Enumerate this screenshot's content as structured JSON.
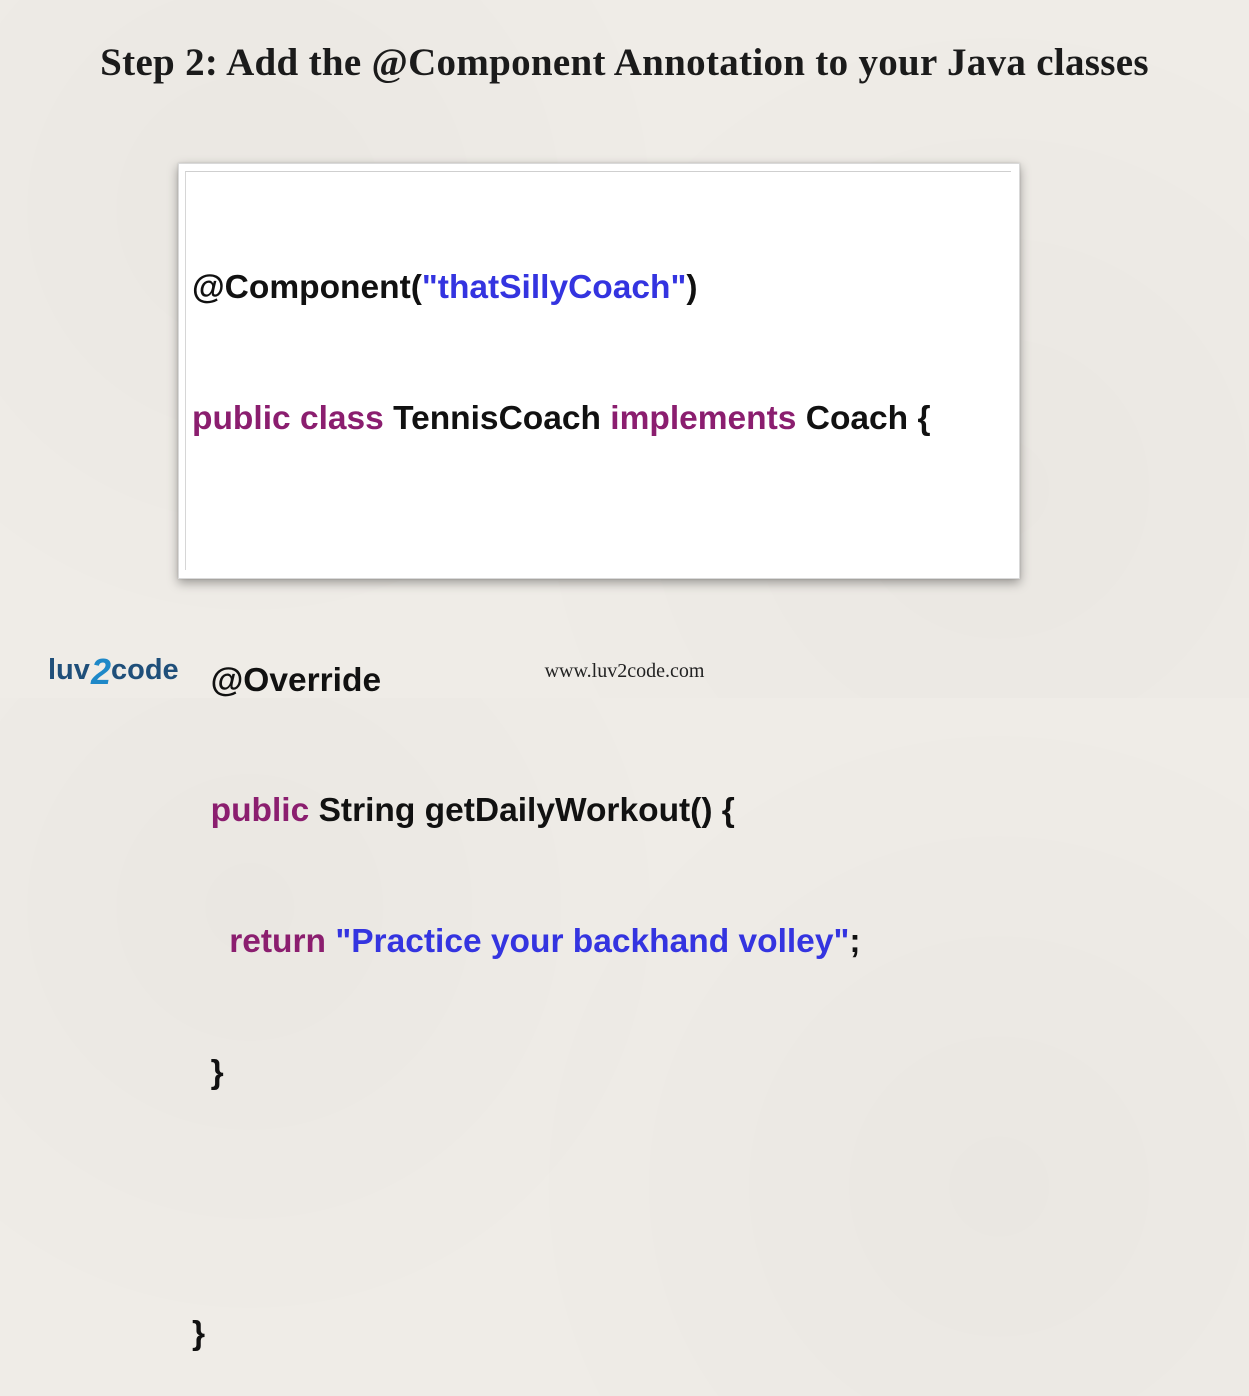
{
  "slide": {
    "title": "Step 2: Add the @Component Annotation to your Java classes",
    "footer_url": "www.luv2code.com"
  },
  "logo": {
    "text_a": "luv",
    "text_b": "2",
    "text_c": "code",
    "color_dark": "#1f4f7a",
    "color_accent": "#1e88c8"
  },
  "code": {
    "line1": {
      "p1": "@Component(",
      "p2": "\"thatSillyCoach\"",
      "p3": ")"
    },
    "line2": {
      "p1": "public class ",
      "p2": "TennisCoach ",
      "p3": "implements ",
      "p4": "Coach {"
    },
    "line3": "",
    "line4": {
      "p1": "  @Override"
    },
    "line5": {
      "p1": "  public ",
      "p2": "String getDailyWorkout() {"
    },
    "line6": {
      "p1": "    return ",
      "p2": "\"Practice your backhand volley\"",
      "p3": ";"
    },
    "line7": {
      "p1": "  }"
    },
    "line8": "",
    "line9": {
      "p1": "}"
    },
    "colors": {
      "keyword": "#8b1e6f",
      "string": "#3434e0",
      "text": "#111111"
    }
  }
}
